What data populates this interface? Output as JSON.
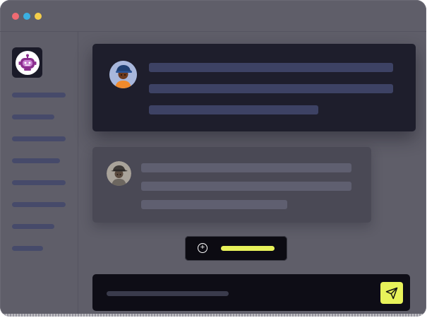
{
  "colors": {
    "window_bg": "#5f5e69",
    "dot_red": "#ef6b73",
    "dot_blue": "#3ab0e2",
    "dot_yellow": "#f4cd4a",
    "accent": "#e8f25a",
    "card_primary_line": "#3d4264",
    "card_secondary_line": "#5f5f70"
  },
  "titlebar": {
    "controls": [
      "close-dot",
      "minimize-dot",
      "zoom-dot"
    ]
  },
  "sidebar": {
    "logo_icon": "robot-icon",
    "item_count": 8
  },
  "messages": [
    {
      "avatar_icon": "person-with-hat-avatar",
      "line_count": 3
    },
    {
      "avatar_icon": "person-with-fedora-avatar",
      "line_count": 3
    }
  ],
  "action": {
    "icon": "plus-circle-icon"
  },
  "composer": {
    "send_icon": "paper-plane-icon"
  }
}
